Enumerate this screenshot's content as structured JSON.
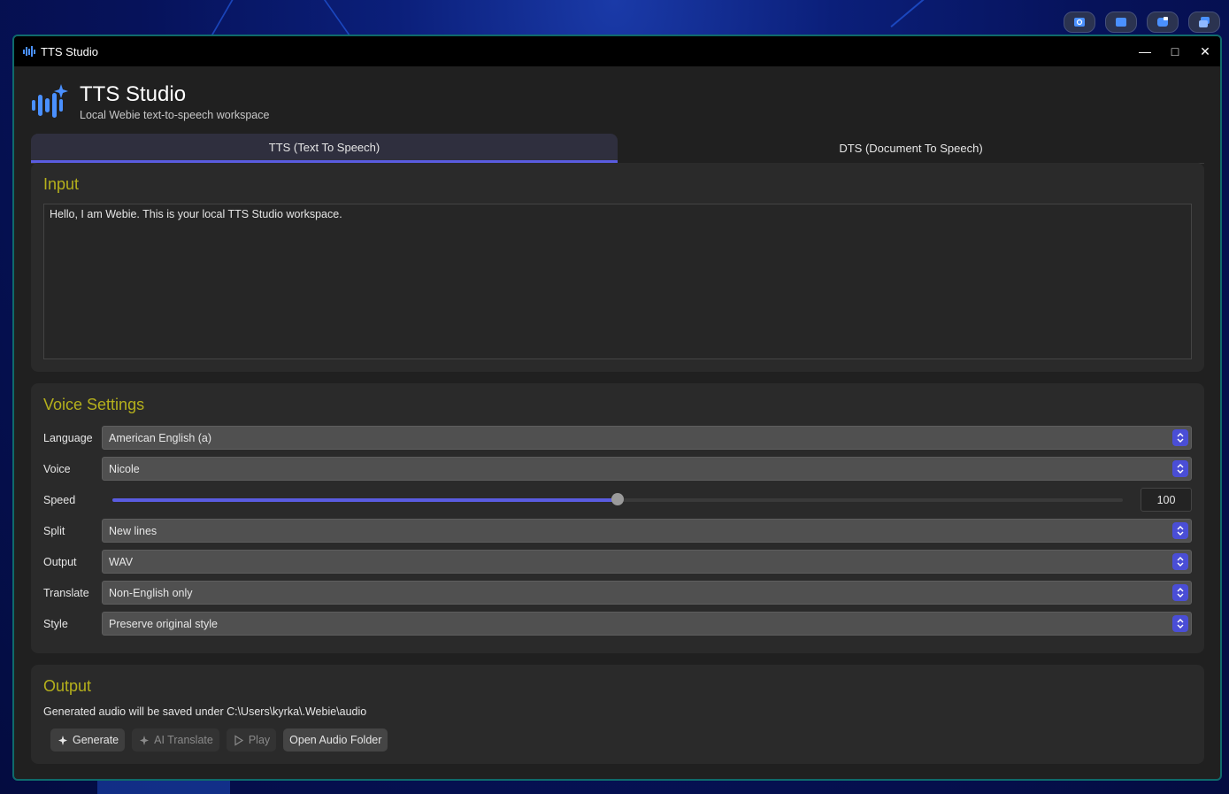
{
  "window": {
    "title": "TTS Studio"
  },
  "header": {
    "title": "TTS Studio",
    "subtitle": "Local Webie text-to-speech workspace"
  },
  "tabs": [
    {
      "label": "TTS (Text To Speech)",
      "active": true
    },
    {
      "label": "DTS (Document To Speech)",
      "active": false
    }
  ],
  "input": {
    "title": "Input",
    "text": "Hello, I am Webie. This is your local TTS Studio workspace."
  },
  "voice": {
    "title": "Voice Settings",
    "language": {
      "label": "Language",
      "value": "American English (a)"
    },
    "voice": {
      "label": "Voice",
      "value": "Nicole"
    },
    "speed": {
      "label": "Speed",
      "value": "100",
      "level": 0.5
    },
    "split": {
      "label": "Split",
      "value": "New lines"
    },
    "output": {
      "label": "Output",
      "value": "WAV"
    },
    "translate": {
      "label": "Translate",
      "value": "Non-English only"
    },
    "style": {
      "label": "Style",
      "value": "Preserve original style"
    }
  },
  "output": {
    "title": "Output",
    "path_text": "Generated audio will be saved under C:\\Users\\kyrka\\.Webie\\audio",
    "generate_label": "Generate",
    "translate_label": "AI Translate",
    "play_label": "Play",
    "folder_label": "Open Audio Folder"
  },
  "colors": {
    "accent": "#5a5ce0",
    "section_title": "#b5b01c",
    "window_border": "#0f6b6b"
  }
}
